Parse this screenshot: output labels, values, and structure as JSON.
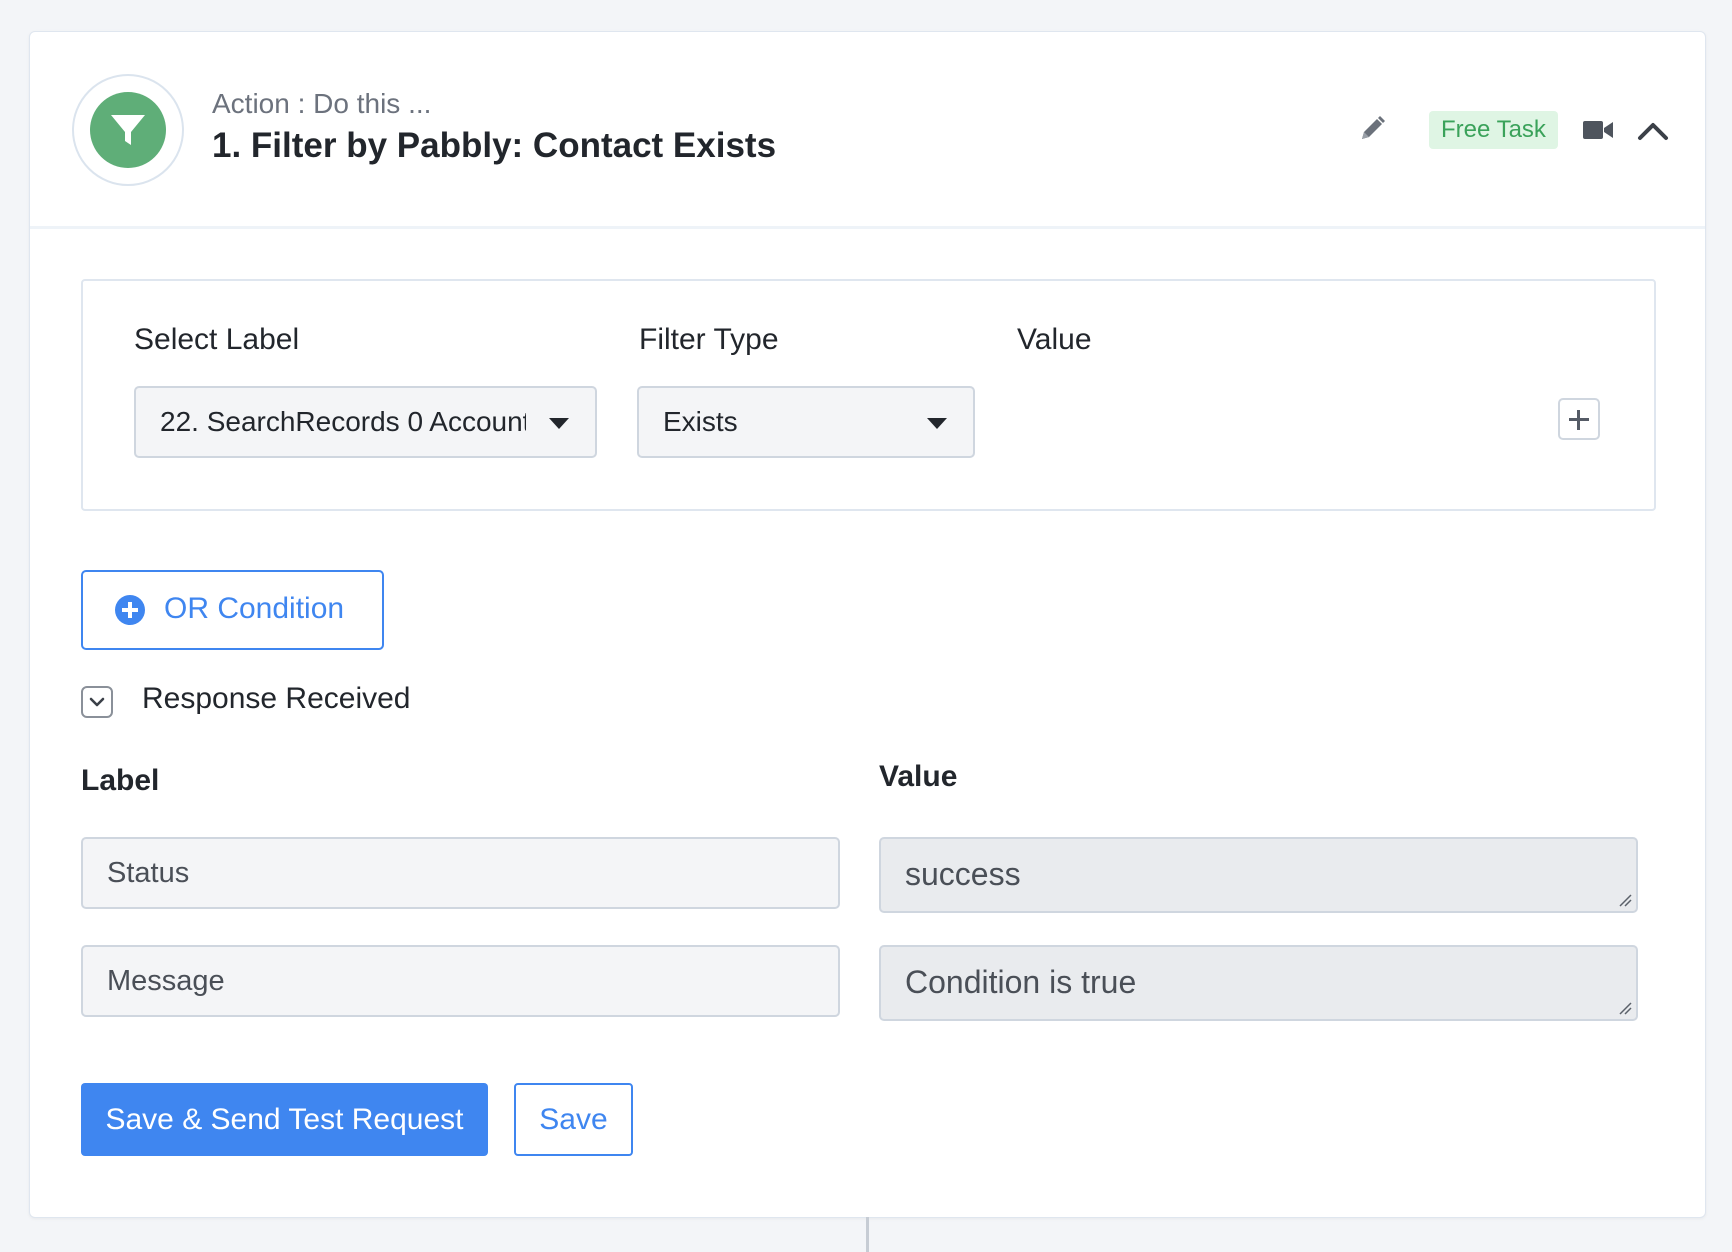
{
  "header": {
    "eyebrow": "Action : Do this ...",
    "title": "1. Filter by Pabbly: Contact Exists",
    "badge": "Free Task",
    "logo_icon": "filter-icon",
    "accent": "#5fae78"
  },
  "filter": {
    "select_label_heading": "Select Label",
    "filter_type_heading": "Filter Type",
    "value_heading": "Value",
    "selected_label": "22. SearchRecords 0 Account",
    "selected_filter_type": "Exists"
  },
  "or_condition_label": "OR Condition",
  "response": {
    "heading": "Response Received",
    "label_column": "Label",
    "value_column": "Value",
    "rows": [
      {
        "label": "Status",
        "value": "success"
      },
      {
        "label": "Message",
        "value": "Condition is true"
      }
    ]
  },
  "actions": {
    "primary": "Save & Send Test Request",
    "secondary": "Save"
  },
  "colors": {
    "primary": "#3f86f0",
    "badge_bg": "#dff5e4",
    "badge_text": "#3aa25a"
  }
}
